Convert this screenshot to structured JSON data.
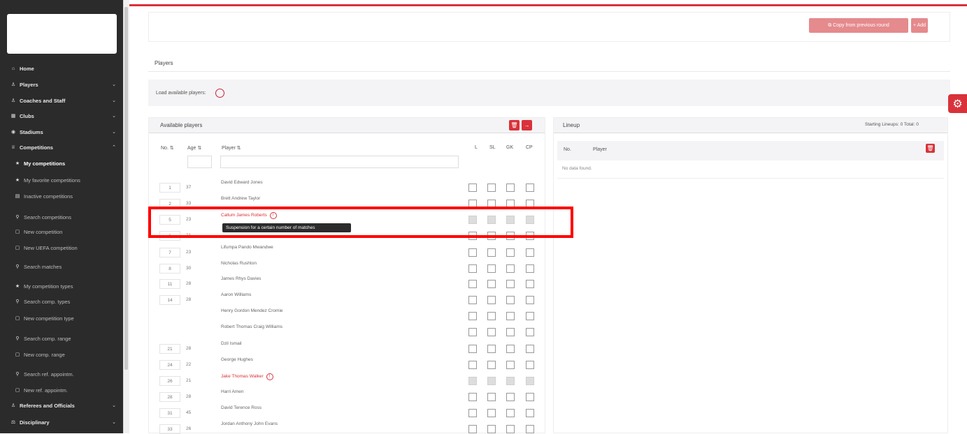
{
  "sidebar": {
    "items": [
      {
        "label": "Home",
        "icon": "home-icon",
        "glyph": "⌂",
        "chevron": ""
      },
      {
        "label": "Players",
        "icon": "user-icon",
        "glyph": "♙",
        "chevron": "⌄"
      },
      {
        "label": "Coaches and Staff",
        "icon": "staff-icon",
        "glyph": "♙",
        "chevron": "⌄"
      },
      {
        "label": "Clubs",
        "icon": "clubs-icon",
        "glyph": "▦",
        "chevron": "⌄"
      },
      {
        "label": "Stadiums",
        "icon": "stadium-icon",
        "glyph": "◉",
        "chevron": "⌄"
      },
      {
        "label": "Competitions",
        "icon": "trophy-icon",
        "glyph": "♕",
        "chevron": "⌃"
      }
    ],
    "sub_items": [
      {
        "label": "My competitions",
        "icon": "star-icon",
        "glyph": "★"
      },
      {
        "label": "My favorite competitions",
        "icon": "star-icon",
        "glyph": "★"
      },
      {
        "label": "Inactive competitions",
        "icon": "archive-icon",
        "glyph": "▤"
      },
      {
        "label": "Search competitions",
        "icon": "search-icon",
        "glyph": "⚲"
      },
      {
        "label": "New competition",
        "icon": "new-icon",
        "glyph": "▢"
      },
      {
        "label": "New UEFA competition",
        "icon": "new-icon",
        "glyph": "▢"
      },
      {
        "label": "Search matches",
        "icon": "search-icon",
        "glyph": "⚲"
      },
      {
        "label": "My competition types",
        "icon": "star-icon",
        "glyph": "★"
      },
      {
        "label": "Search comp. types",
        "icon": "search-icon",
        "glyph": "⚲"
      },
      {
        "label": "New competition type",
        "icon": "new-icon",
        "glyph": "▢"
      },
      {
        "label": "Search comp. range",
        "icon": "search-icon",
        "glyph": "⚲"
      },
      {
        "label": "New comp. range",
        "icon": "new-icon",
        "glyph": "▢"
      },
      {
        "label": "Search ref. appointm.",
        "icon": "search-icon",
        "glyph": "⚲"
      },
      {
        "label": "New ref. appointm.",
        "icon": "new-icon",
        "glyph": "▢"
      }
    ],
    "bottom_items": [
      {
        "label": "Referees and Officials",
        "icon": "referee-icon",
        "glyph": "♙",
        "chevron": "⌄"
      },
      {
        "label": "Disciplinary",
        "icon": "gavel-icon",
        "glyph": "⚖",
        "chevron": "⌄"
      }
    ]
  },
  "toolbar": {
    "copy_label": "⧉ Copy from previous round",
    "add_label": "+ Add"
  },
  "players_heading": "Players",
  "load_label": "Load available players:",
  "available": {
    "title": "Available players",
    "delete_glyph": "🗑",
    "move_glyph": "→",
    "columns": {
      "no": "No. ⇅",
      "age": "Age ⇅",
      "player": "Player ⇅",
      "l": "L",
      "sl": "SL",
      "gk": "GK",
      "cp": "CP"
    },
    "rows": [
      {
        "no": "1",
        "age": "37",
        "name": "David Edward Jones",
        "red": false,
        "info": "",
        "disabled": false
      },
      {
        "no": "2",
        "age": "33",
        "name": "Brett Andrew Taylor",
        "red": false,
        "info": "",
        "disabled": false
      },
      {
        "no": "5",
        "age": "23",
        "name": "Callum James Roberts",
        "red": true,
        "info": "!",
        "disabled": true
      },
      {
        "no": "6",
        "age": "21",
        "name": "",
        "red": false,
        "info": "",
        "disabled": false
      },
      {
        "no": "7",
        "age": "23",
        "name": "Lifumpa Pando Mwandwe",
        "red": false,
        "info": "",
        "disabled": false
      },
      {
        "no": "8",
        "age": "30",
        "name": "Nicholas Rushton",
        "red": false,
        "info": "",
        "disabled": false
      },
      {
        "no": "11",
        "age": "28",
        "name": "James Rhys Davies",
        "red": false,
        "info": "",
        "disabled": false
      },
      {
        "no": "14",
        "age": "28",
        "name": "Aaron Williams",
        "red": false,
        "info": "",
        "disabled": false
      },
      {
        "no": "",
        "age": "",
        "name": "Henry Gordon Mendez Cromie",
        "red": false,
        "info": "",
        "disabled": false
      },
      {
        "no": "",
        "age": "",
        "name": "Robert Thomas Craig Williams",
        "red": false,
        "info": "",
        "disabled": false
      },
      {
        "no": "21",
        "age": "28",
        "name": "Dzil Ismail",
        "red": false,
        "info": "",
        "disabled": false
      },
      {
        "no": "24",
        "age": "22",
        "name": "George Hughes",
        "red": false,
        "info": "",
        "disabled": false
      },
      {
        "no": "26",
        "age": "21",
        "name": "Jake Thomas Walker",
        "red": true,
        "info": "!",
        "disabled": true
      },
      {
        "no": "28",
        "age": "28",
        "name": "Harri Amen",
        "red": false,
        "info": "",
        "disabled": false
      },
      {
        "no": "31",
        "age": "45",
        "name": "David Terence Ross",
        "red": false,
        "info": "",
        "disabled": false
      },
      {
        "no": "33",
        "age": "26",
        "name": "Jordan Anthony John Evans",
        "red": false,
        "info": "",
        "disabled": false
      }
    ],
    "tooltip": "Suspension for a certain number of matches"
  },
  "lineup": {
    "title": "Lineup",
    "stats": "Starting Lineups: 0   Total: 0",
    "col_no": "No.",
    "col_player": "Player",
    "delete_glyph": "🗑",
    "no_data": "No data found."
  },
  "colors": {
    "accent": "#d9323a",
    "sidebar_bg": "#2b2b2b",
    "highlight": "#ff0000"
  }
}
